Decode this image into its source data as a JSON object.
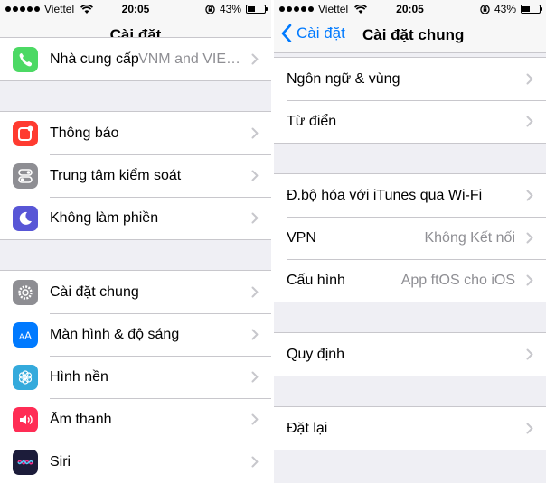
{
  "left": {
    "status": {
      "carrier": "Viettel",
      "time": "20:05",
      "battery": "43%",
      "battery_level": 0.43
    },
    "nav": {
      "title": "Cài đặt"
    },
    "groups": [
      [
        {
          "label": "Nhà cung cấp",
          "value": "VNM and VIE…",
          "icon": "phone-icon",
          "color": "#4cd964"
        }
      ],
      [
        {
          "label": "Thông báo",
          "icon": "notifications-icon",
          "color": "#ff3b30"
        },
        {
          "label": "Trung tâm kiểm soát",
          "icon": "control-center-icon",
          "color": "#8e8e93"
        },
        {
          "label": "Không làm phiền",
          "icon": "moon-icon",
          "color": "#5856d6"
        }
      ],
      [
        {
          "label": "Cài đặt chung",
          "icon": "gear-icon",
          "color": "#8e8e93"
        },
        {
          "label": "Màn hình & độ sáng",
          "icon": "display-brightness-icon",
          "color": "#007aff"
        },
        {
          "label": "Hình nền",
          "icon": "wallpaper-flower-icon",
          "color": "#34aadc"
        },
        {
          "label": "Âm thanh",
          "icon": "speaker-icon",
          "color": "#ff2d55"
        },
        {
          "label": "Siri",
          "icon": "siri-icon",
          "color": "#1c1c3a"
        }
      ]
    ]
  },
  "right": {
    "status": {
      "carrier": "Viettel",
      "time": "20:05",
      "battery": "43%",
      "battery_level": 0.43
    },
    "nav": {
      "back": "Cài đặt",
      "title": "Cài đặt chung"
    },
    "groups": [
      [
        {
          "label": "Ngôn ngữ & vùng"
        },
        {
          "label": "Từ điển"
        }
      ],
      [
        {
          "label": "Đ.bộ hóa với iTunes qua Wi-Fi"
        },
        {
          "label": "VPN",
          "value": "Không Kết nối"
        },
        {
          "label": "Cấu hình",
          "value": "App ftOS cho iOS"
        }
      ],
      [
        {
          "label": "Quy định"
        }
      ],
      [
        {
          "label": "Đặt lại"
        }
      ]
    ]
  },
  "colors": {
    "accent": "#007aff",
    "separator": "#c8c7cc",
    "background": "#efeff4",
    "secondary_text": "#8e8e93"
  }
}
